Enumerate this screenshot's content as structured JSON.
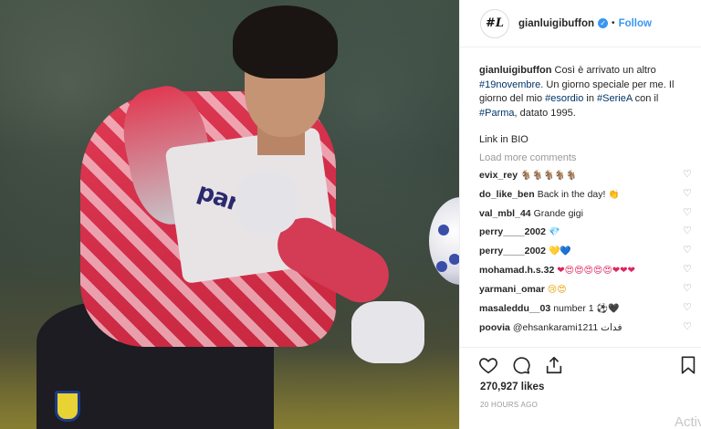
{
  "post": {
    "username": "gianluigibuffon",
    "follow_label": "Follow",
    "avatar_text": "#L",
    "caption": {
      "username": "gianluigibuffon",
      "parts": [
        {
          "text": "Così è arrivato un altro ",
          "tag": false
        },
        {
          "text": "#19novembre",
          "tag": true
        },
        {
          "text": ". Un giorno speciale per me. Il giorno del mio ",
          "tag": false
        },
        {
          "text": "#esordio",
          "tag": true
        },
        {
          "text": " in ",
          "tag": false
        },
        {
          "text": "#SerieA",
          "tag": true
        },
        {
          "text": " con il ",
          "tag": false
        },
        {
          "text": "#Parma",
          "tag": true
        },
        {
          "text": ", datato 1995.",
          "tag": false
        }
      ],
      "link_line": "Link in BIO"
    },
    "load_more": "Load more comments",
    "comments": [
      {
        "user": "evix_rey",
        "text": "",
        "emoji": "🐐🐐🐐🐐🐐",
        "emoji_class": "e-face"
      },
      {
        "user": "do_like_ben",
        "text": "Back in the day!",
        "emoji": "👏",
        "emoji_class": "e-gold"
      },
      {
        "user": "val_mbl_44",
        "text": "Grande gigi",
        "emoji": "",
        "emoji_class": ""
      },
      {
        "user": "perry____2002",
        "text": "",
        "emoji": "💎",
        "emoji_class": "e-blue"
      },
      {
        "user": "perry____2002",
        "text": "",
        "emoji": "💛💙",
        "emoji_class": "e-gold"
      },
      {
        "user": "mohamad.h.s.32",
        "text": "",
        "emoji": "❤😍😍😍😍😍❤❤❤",
        "emoji_class": "e-red"
      },
      {
        "user": "yarmani_omar",
        "text": "",
        "emoji": "😢😍",
        "emoji_class": "e-face"
      },
      {
        "user": "masaleddu__03",
        "text": "number 1",
        "emoji": "⚽🖤",
        "emoji_class": ""
      },
      {
        "user": "poovia",
        "text": "@ehsankarami1211 فدات",
        "emoji": "",
        "emoji_class": ""
      }
    ],
    "likes": "270,927 likes",
    "time": "20 HOURS AGO",
    "overlay": "Activ",
    "photo": {
      "jersey_text": "parma"
    }
  },
  "icons": [
    "heart-icon",
    "comment-icon",
    "share-icon",
    "bookmark-icon",
    "verified-badge-icon"
  ]
}
